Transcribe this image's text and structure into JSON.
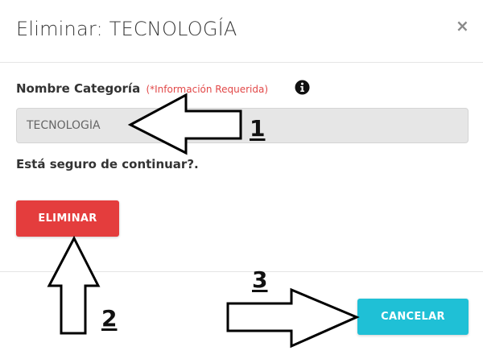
{
  "dialog": {
    "title": "Eliminar: TECNOLOGÍA",
    "close_symbol": "×"
  },
  "form": {
    "field_label": "Nombre Categoría",
    "required_note": "(*Información Requerida)",
    "info_icon": "info-circle-icon",
    "name_value": "TECNOLOGÍA",
    "confirm_question": "Está seguro de continuar?."
  },
  "actions": {
    "delete_label": "ELIMINAR",
    "cancel_label": "CANCELAR"
  },
  "annotations": {
    "step_1": "1",
    "step_2": "2",
    "step_3": "3"
  },
  "colors": {
    "delete_button": "#e43d3d",
    "cancel_button": "#1fc0d6",
    "required_note": "#e24848",
    "input_background": "#e6e6e6"
  }
}
